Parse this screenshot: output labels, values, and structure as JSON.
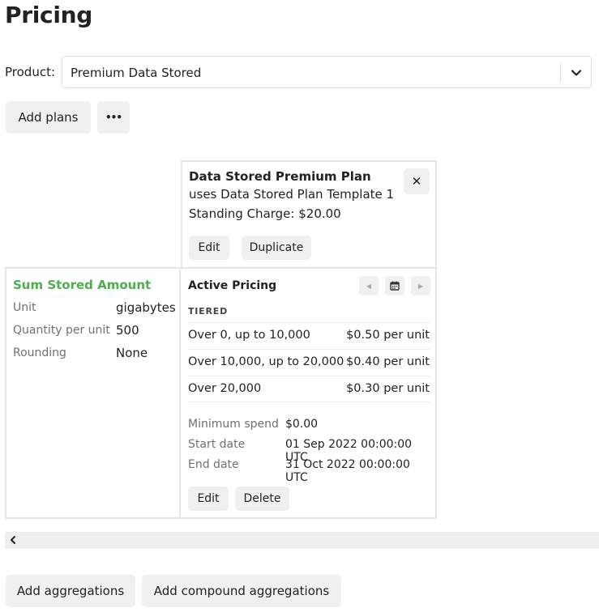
{
  "page": {
    "title": "Pricing"
  },
  "product": {
    "label": "Product:",
    "selected": "Premium Data Stored"
  },
  "toolbar": {
    "add_plans_label": "Add plans",
    "more_label": "•••"
  },
  "plan": {
    "name": "Data Stored Premium Plan",
    "template": "uses Data Stored Plan Template 1",
    "standing_charge": "Standing Charge: $20.00",
    "edit_label": "Edit",
    "duplicate_label": "Duplicate",
    "close_label": "✕"
  },
  "aggregation": {
    "title": "Sum Stored Amount",
    "rows": [
      {
        "key": "Unit",
        "value": "gigabytes"
      },
      {
        "key": "Quantity per unit",
        "value": "500"
      },
      {
        "key": "Rounding",
        "value": "None"
      }
    ]
  },
  "pricing": {
    "title": "Active Pricing",
    "prev_label": "◀",
    "calendar_label": "calendar",
    "next_label": "▶",
    "model": "TIERED",
    "tiers": [
      {
        "range": "Over 0, up to 10,000",
        "price": "$0.50 per unit"
      },
      {
        "range": "Over 10,000, up to 20,000",
        "price": "$0.40 per unit"
      },
      {
        "range": "Over 20,000",
        "price": "$0.30 per unit"
      }
    ],
    "meta": [
      {
        "key": "Minimum spend",
        "value": "$0.00"
      },
      {
        "key": "Start date",
        "value": "01 Sep 2022 00:00:00 UTC"
      },
      {
        "key": "End date",
        "value": "31 Oct 2022 00:00:00 UTC"
      }
    ],
    "edit_label": "Edit",
    "delete_label": "Delete"
  },
  "footer": {
    "add_aggregations_label": "Add aggregations",
    "add_compound_label": "Add compound aggregations"
  },
  "colors": {
    "aggregation_title": "#4caf50",
    "button_bg": "#f0f0f0",
    "border": "#e6e6e6"
  }
}
